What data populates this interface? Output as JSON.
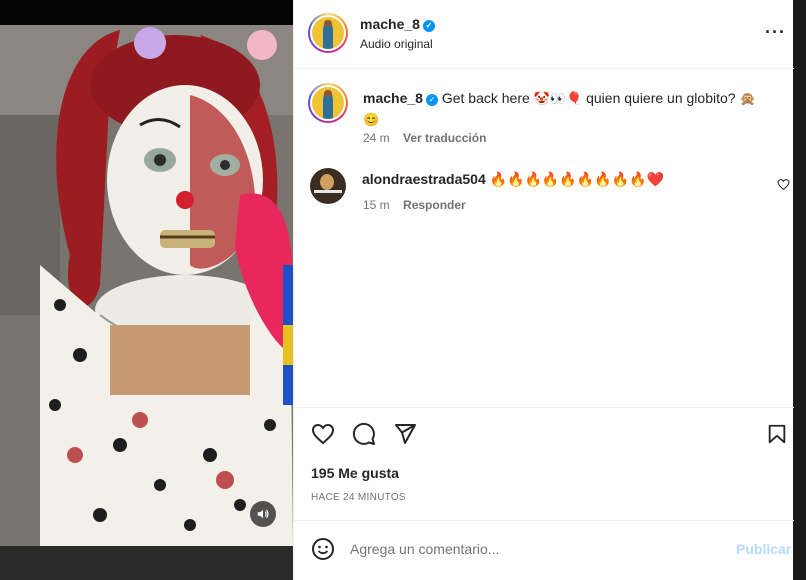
{
  "colors": {
    "accent": "#0095f6",
    "text": "#262626",
    "muted": "#737373",
    "post_disabled": "#b3dbff"
  },
  "post": {
    "author": "mache_8",
    "audio": "Audio original",
    "caption": {
      "username": "mache_8",
      "text": "Get back here",
      "emojis_a": "🤡👀🎈",
      "text2": "quien quiere un globito?",
      "emojis_b": "🙊",
      "emojis_c": "😊",
      "time": "24 m",
      "translate": "Ver traducción"
    },
    "comments": [
      {
        "username": "alondraestrada504",
        "text": "🔥🔥🔥🔥🔥🔥🔥🔥🔥❤️",
        "time": "15 m",
        "reply": "Responder"
      }
    ],
    "likes": "195 Me gusta",
    "posted": "HACE 24 MINUTOS"
  },
  "icons": [
    "verified-icon",
    "more-icon",
    "heart-icon",
    "comment-icon",
    "share-icon",
    "bookmark-icon",
    "emoji-icon",
    "volume-icon"
  ],
  "composer": {
    "placeholder": "Agrega un comentario...",
    "post_label": "Publicar"
  }
}
